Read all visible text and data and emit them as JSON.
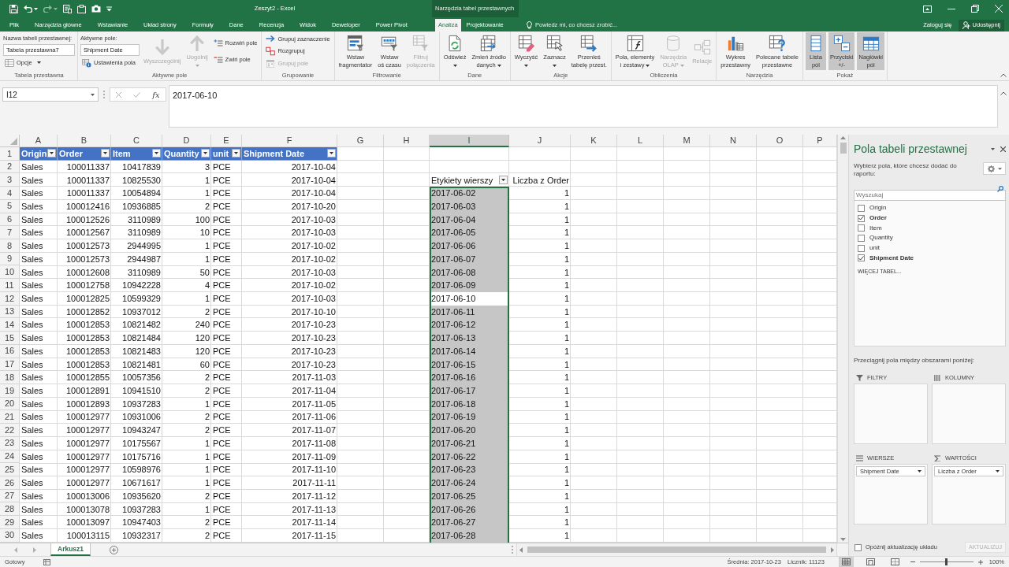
{
  "title_bar": {
    "title": "Zeszyt2 - Excel"
  },
  "tabs": [
    {
      "label": "Plik",
      "selected": false
    },
    {
      "label": "Narzędzia główne",
      "selected": false
    },
    {
      "label": "Wstawianie",
      "selected": false
    },
    {
      "label": "Układ strony",
      "selected": false
    },
    {
      "label": "Formuły",
      "selected": false
    },
    {
      "label": "Dane",
      "selected": false
    },
    {
      "label": "Recenzja",
      "selected": false
    },
    {
      "label": "Widok",
      "selected": false
    },
    {
      "label": "Deweloper",
      "selected": false
    },
    {
      "label": "Power Pivot",
      "selected": false
    }
  ],
  "context_tabs": {
    "label": "Narzędzia tabel przestawnych",
    "tabs": [
      {
        "label": "Analiza",
        "selected": true
      },
      {
        "label": "Projektowanie",
        "selected": false
      }
    ]
  },
  "tell_me": "Powiedz mi, co chcesz zrobić...",
  "account": {
    "sign_in": "Zaloguj się",
    "share": "Udostępnij"
  },
  "ribbon": {
    "groups": [
      {
        "label": "Tabela przestawna",
        "items": [
          {
            "kind": "field",
            "label": "Nazwa tabeli przestawnej:",
            "value": "Tabela przestawna7"
          },
          {
            "kind": "small",
            "label": "Opcje",
            "has_menu": true,
            "disabled": false
          }
        ]
      },
      {
        "label": "Aktywne pole",
        "items": [
          {
            "kind": "field",
            "label": "Aktywne pole:",
            "value": "Shipment Date"
          },
          {
            "kind": "small",
            "label": "Ustawienia pola",
            "has_menu": false,
            "disabled": false
          },
          {
            "kind": "large",
            "lines": [
              "Wyszczególnij"
            ],
            "has_menu": false,
            "disabled": true
          },
          {
            "kind": "large",
            "lines": [
              "Uogólnij"
            ],
            "has_menu": true,
            "disabled": true
          },
          {
            "kind": "small",
            "label": "Rozwiń pole",
            "has_menu": false,
            "disabled": false
          },
          {
            "kind": "small",
            "label": "Zwiń pole",
            "has_menu": false,
            "disabled": false
          }
        ]
      },
      {
        "label": "Grupowanie",
        "items": [
          {
            "kind": "small",
            "label": "Grupuj zaznaczenie",
            "has_menu": false,
            "disabled": false
          },
          {
            "kind": "small",
            "label": "Rozgrupuj",
            "has_menu": false,
            "disabled": false
          },
          {
            "kind": "small",
            "label": "Grupuj pole",
            "has_menu": false,
            "disabled": true
          }
        ]
      },
      {
        "label": "Filtrowanie",
        "items": [
          {
            "kind": "large",
            "lines": [
              "Wstaw",
              "fragmentator"
            ],
            "has_menu": false,
            "disabled": false
          },
          {
            "kind": "large",
            "lines": [
              "Wstaw",
              "oś czasu"
            ],
            "has_menu": false,
            "disabled": false
          },
          {
            "kind": "large",
            "lines": [
              "Filtruj",
              "połączenia"
            ],
            "has_menu": false,
            "disabled": true
          }
        ]
      },
      {
        "label": "Dane",
        "items": [
          {
            "kind": "large",
            "lines": [
              "Odśwież"
            ],
            "has_menu": true,
            "disabled": false
          },
          {
            "kind": "large",
            "lines": [
              "Zmień źródło",
              "danych"
            ],
            "has_menu": true,
            "disabled": false
          }
        ]
      },
      {
        "label": "Akcje",
        "items": [
          {
            "kind": "large",
            "lines": [
              "Wyczyść"
            ],
            "has_menu": true,
            "disabled": false
          },
          {
            "kind": "large",
            "lines": [
              "Zaznacz"
            ],
            "has_menu": true,
            "disabled": false
          },
          {
            "kind": "large",
            "lines": [
              "Przenieś",
              "tabelę przest."
            ],
            "has_menu": false,
            "disabled": false
          }
        ]
      },
      {
        "label": "Obliczenia",
        "items": [
          {
            "kind": "large",
            "lines": [
              "Pola, elementy",
              "i zestawy"
            ],
            "has_menu": true,
            "disabled": false
          },
          {
            "kind": "large",
            "lines": [
              "Narzędzia",
              "OLAP"
            ],
            "has_menu": true,
            "disabled": true
          },
          {
            "kind": "large",
            "lines": [
              "Relacje"
            ],
            "has_menu": false,
            "disabled": true
          }
        ]
      },
      {
        "label": "Narzędzia",
        "items": [
          {
            "kind": "large",
            "lines": [
              "Wykres",
              "przestawny"
            ],
            "has_menu": false,
            "disabled": false
          },
          {
            "kind": "large",
            "lines": [
              "Polecane tabele",
              "przestawne"
            ],
            "has_menu": false,
            "disabled": false
          }
        ]
      },
      {
        "label": "Pokaż",
        "items": [
          {
            "kind": "large",
            "lines": [
              "Lista",
              "pól"
            ],
            "has_menu": false,
            "disabled": false,
            "on": true
          },
          {
            "kind": "large",
            "lines": [
              "Przyciski",
              "+/-"
            ],
            "has_menu": false,
            "disabled": false,
            "on": true
          },
          {
            "kind": "large",
            "lines": [
              "Nagłówki",
              "pól"
            ],
            "has_menu": false,
            "disabled": false,
            "on": true
          }
        ]
      }
    ]
  },
  "formula_bar": {
    "name_box": "I12",
    "function_button": "fx",
    "value": "2017-06-10"
  },
  "sheet": {
    "columns": [
      {
        "label": "A",
        "selected": false
      },
      {
        "label": "B",
        "selected": false
      },
      {
        "label": "C",
        "selected": false
      },
      {
        "label": "D",
        "selected": false
      },
      {
        "label": "E",
        "selected": false
      },
      {
        "label": "F",
        "selected": false
      },
      {
        "label": "G",
        "selected": false
      },
      {
        "label": "H",
        "selected": false
      },
      {
        "label": "I",
        "selected": true
      },
      {
        "label": "J",
        "selected": false
      },
      {
        "label": "K",
        "selected": false
      },
      {
        "label": "L",
        "selected": false
      },
      {
        "label": "M",
        "selected": false
      },
      {
        "label": "N",
        "selected": false
      },
      {
        "label": "O",
        "selected": false
      },
      {
        "label": "P",
        "selected": false
      }
    ],
    "row_numbers": [
      "1",
      "2",
      "3",
      "4",
      "5",
      "6",
      "7",
      "8",
      "9",
      "10",
      "11",
      "12",
      "13",
      "14",
      "15",
      "16",
      "17",
      "18",
      "19",
      "20",
      "21",
      "22",
      "23",
      "24",
      "25",
      "26",
      "27",
      "28",
      "29",
      "30"
    ],
    "table": {
      "columns": [
        "Origin",
        "Order",
        "Item",
        "Quantity",
        "unit",
        "Shipment Date"
      ],
      "rows": [
        [
          "Sales",
          "100011337",
          "10417839",
          "3",
          "PCE",
          "2017-10-04"
        ],
        [
          "Sales",
          "100011337",
          "10825530",
          "1",
          "PCE",
          "2017-10-04"
        ],
        [
          "Sales",
          "100011337",
          "10054894",
          "1",
          "PCE",
          "2017-10-04"
        ],
        [
          "Sales",
          "100012416",
          "10936885",
          "2",
          "PCE",
          "2017-10-20"
        ],
        [
          "Sales",
          "100012526",
          "3110989",
          "100",
          "PCE",
          "2017-10-03"
        ],
        [
          "Sales",
          "100012567",
          "3110989",
          "10",
          "PCE",
          "2017-10-03"
        ],
        [
          "Sales",
          "100012573",
          "2944995",
          "1",
          "PCE",
          "2017-10-02"
        ],
        [
          "Sales",
          "100012573",
          "2944987",
          "1",
          "PCE",
          "2017-10-02"
        ],
        [
          "Sales",
          "100012608",
          "3110989",
          "50",
          "PCE",
          "2017-10-03"
        ],
        [
          "Sales",
          "100012758",
          "10942228",
          "4",
          "PCE",
          "2017-10-02"
        ],
        [
          "Sales",
          "100012825",
          "10599329",
          "1",
          "PCE",
          "2017-10-03"
        ],
        [
          "Sales",
          "100012852",
          "10937012",
          "2",
          "PCE",
          "2017-10-10"
        ],
        [
          "Sales",
          "100012853",
          "10821482",
          "240",
          "PCE",
          "2017-10-23"
        ],
        [
          "Sales",
          "100012853",
          "10821484",
          "120",
          "PCE",
          "2017-10-23"
        ],
        [
          "Sales",
          "100012853",
          "10821483",
          "120",
          "PCE",
          "2017-10-23"
        ],
        [
          "Sales",
          "100012853",
          "10821481",
          "60",
          "PCE",
          "2017-10-23"
        ],
        [
          "Sales",
          "100012855",
          "10057356",
          "2",
          "PCE",
          "2017-11-03"
        ],
        [
          "Sales",
          "100012891",
          "10941510",
          "2",
          "PCE",
          "2017-11-04"
        ],
        [
          "Sales",
          "100012893",
          "10937283",
          "1",
          "PCE",
          "2017-11-05"
        ],
        [
          "Sales",
          "100012977",
          "10931006",
          "2",
          "PCE",
          "2017-11-06"
        ],
        [
          "Sales",
          "100012977",
          "10943247",
          "2",
          "PCE",
          "2017-11-07"
        ],
        [
          "Sales",
          "100012977",
          "10175567",
          "1",
          "PCE",
          "2017-11-08"
        ],
        [
          "Sales",
          "100012977",
          "10175716",
          "1",
          "PCE",
          "2017-11-09"
        ],
        [
          "Sales",
          "100012977",
          "10598976",
          "1",
          "PCE",
          "2017-11-10"
        ],
        [
          "Sales",
          "100012977",
          "10671617",
          "1",
          "PCE",
          "2017-11-11"
        ],
        [
          "Sales",
          "100013006",
          "10935620",
          "2",
          "PCE",
          "2017-11-12"
        ],
        [
          "Sales",
          "100013078",
          "10937283",
          "1",
          "PCE",
          "2017-11-13"
        ],
        [
          "Sales",
          "100013097",
          "10947403",
          "2",
          "PCE",
          "2017-11-14"
        ],
        [
          "Sales",
          "100013115",
          "10932317",
          "2",
          "PCE",
          "2017-11-15"
        ]
      ]
    },
    "pivot": {
      "row_label_header": "Etykiety wierszy",
      "value_header": "Liczba z Order",
      "rows": [
        {
          "label": "2017-06-02",
          "value": "1",
          "selected": true,
          "active": false
        },
        {
          "label": "2017-06-03",
          "value": "1",
          "selected": true,
          "active": false
        },
        {
          "label": "2017-06-04",
          "value": "1",
          "selected": true,
          "active": false
        },
        {
          "label": "2017-06-05",
          "value": "1",
          "selected": true,
          "active": false
        },
        {
          "label": "2017-06-06",
          "value": "1",
          "selected": true,
          "active": false
        },
        {
          "label": "2017-06-07",
          "value": "1",
          "selected": true,
          "active": false
        },
        {
          "label": "2017-06-08",
          "value": "1",
          "selected": true,
          "active": false
        },
        {
          "label": "2017-06-09",
          "value": "1",
          "selected": true,
          "active": false
        },
        {
          "label": "2017-06-10",
          "value": "1",
          "selected": true,
          "active": true
        },
        {
          "label": "2017-06-11",
          "value": "1",
          "selected": true,
          "active": false
        },
        {
          "label": "2017-06-12",
          "value": "1",
          "selected": true,
          "active": false
        },
        {
          "label": "2017-06-13",
          "value": "1",
          "selected": true,
          "active": false
        },
        {
          "label": "2017-06-14",
          "value": "1",
          "selected": true,
          "active": false
        },
        {
          "label": "2017-06-15",
          "value": "1",
          "selected": true,
          "active": false
        },
        {
          "label": "2017-06-16",
          "value": "1",
          "selected": true,
          "active": false
        },
        {
          "label": "2017-06-17",
          "value": "1",
          "selected": true,
          "active": false
        },
        {
          "label": "2017-06-18",
          "value": "1",
          "selected": true,
          "active": false
        },
        {
          "label": "2017-06-19",
          "value": "1",
          "selected": true,
          "active": false
        },
        {
          "label": "2017-06-20",
          "value": "1",
          "selected": true,
          "active": false
        },
        {
          "label": "2017-06-21",
          "value": "1",
          "selected": true,
          "active": false
        },
        {
          "label": "2017-06-22",
          "value": "1",
          "selected": true,
          "active": false
        },
        {
          "label": "2017-06-23",
          "value": "1",
          "selected": true,
          "active": false
        },
        {
          "label": "2017-06-24",
          "value": "1",
          "selected": true,
          "active": false
        },
        {
          "label": "2017-06-25",
          "value": "1",
          "selected": true,
          "active": false
        },
        {
          "label": "2017-06-26",
          "value": "1",
          "selected": true,
          "active": false
        },
        {
          "label": "2017-06-27",
          "value": "1",
          "selected": true,
          "active": false
        },
        {
          "label": "2017-06-28",
          "value": "1",
          "selected": true,
          "active": false
        }
      ]
    }
  },
  "sheet_tabs": [
    {
      "label": "Arkusz1",
      "selected": true
    }
  ],
  "field_pane": {
    "title": "Pola tabeli przestawnej",
    "instruction": "Wybierz pola, które chcesz dodać do raportu:",
    "search": {
      "placeholder": "Wyszukaj"
    },
    "fields": [
      {
        "label": "Origin",
        "checked": false
      },
      {
        "label": "Order",
        "checked": true
      },
      {
        "label": "Item",
        "checked": false
      },
      {
        "label": "Quantity",
        "checked": false
      },
      {
        "label": "unit",
        "checked": false
      },
      {
        "label": "Shipment Date",
        "checked": true
      }
    ],
    "more_tables": "WIĘCEJ TABEL...",
    "drag_hint": "Przeciągnij pola między obszarami poniżej:",
    "areas": [
      {
        "label": "FILTRY"
      },
      {
        "label": "KOLUMNY"
      },
      {
        "label": "WIERSZE",
        "fields": [
          "Shipment Date"
        ]
      },
      {
        "label": "WARTOŚCI",
        "fields": [
          "Liczba z Order"
        ]
      }
    ],
    "defer": {
      "label": "Opóźnij aktualizację układu",
      "checked": false
    },
    "update_button": {
      "label": "AKTUALIZUJ",
      "disabled": true
    }
  },
  "status_bar": {
    "status": "Gotowy",
    "average": "Średnia: 2017-10-23",
    "count": "Licznik: 11123",
    "views": [
      {
        "selected": true
      },
      {
        "selected": false
      },
      {
        "selected": false
      }
    ],
    "zoom": {
      "level": 0.5,
      "reading": "100%"
    }
  }
}
